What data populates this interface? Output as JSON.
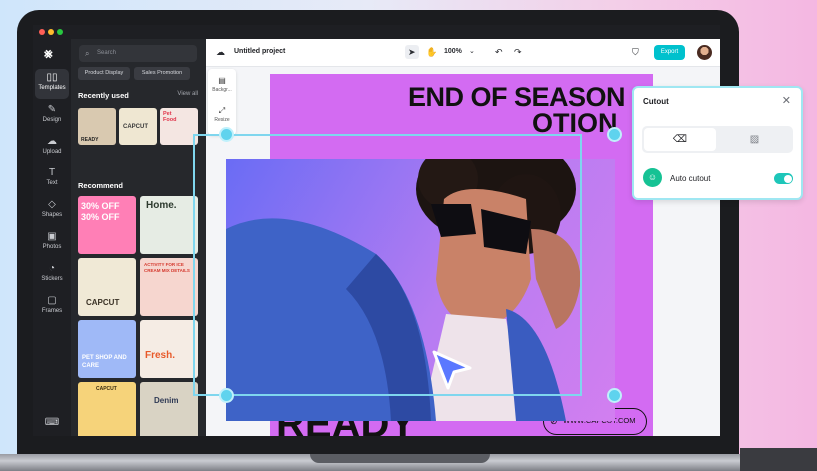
{
  "window": {
    "traffic_lights": [
      "#ff5f57",
      "#febc2e",
      "#28c840"
    ]
  },
  "rail": {
    "logo_icon": "capcut-logo-icon",
    "items": [
      {
        "label": "Templates",
        "icon": "templates-icon",
        "active": true
      },
      {
        "label": "Design",
        "icon": "design-icon"
      },
      {
        "label": "Upload",
        "icon": "upload-icon"
      },
      {
        "label": "Text",
        "icon": "text-icon"
      },
      {
        "label": "Shapes",
        "icon": "shapes-icon"
      },
      {
        "label": "Photos",
        "icon": "photos-icon"
      },
      {
        "label": "Stickers",
        "icon": "stickers-icon"
      },
      {
        "label": "Frames",
        "icon": "frames-icon"
      }
    ]
  },
  "panel": {
    "search_placeholder": "Search",
    "chips": [
      "Product Display",
      "Sales Promotion"
    ],
    "recently_used": "Recently used",
    "view_all": "View all",
    "recent_thumbs": [
      {
        "text": "READY",
        "color": "#d9c9b0"
      },
      {
        "text": "CAPCUT",
        "color": "#efe7d2"
      },
      {
        "text": "Pet Food",
        "color": "#f4e6e2"
      }
    ],
    "recommend": "Recommend",
    "grid": [
      {
        "text": "30% OFF 30% OFF",
        "color": "#ff7fb6"
      },
      {
        "text": "Home.",
        "color": "#e6ece4"
      },
      {
        "text": "CAPCUT",
        "color": "#f0e9d6"
      },
      {
        "text": "ACTIVITY FOR ICE CREAM MIX DETAILS",
        "color": "#f6d6cf"
      },
      {
        "text": "PET SHOP AND CARE",
        "color": "#9fb9f7"
      },
      {
        "text": "Fresh.",
        "color": "#f5ece4"
      },
      {
        "text": "CAPCUT",
        "color": "#f6d37a"
      },
      {
        "text": "Denim",
        "color": "#d9d3c4"
      }
    ]
  },
  "topbar": {
    "project_title": "Untitled project",
    "zoom": "100%",
    "export_label": "Export",
    "cloud_icon": "cloud-icon",
    "select_icon": "pointer-icon",
    "hand_icon": "hand-icon",
    "undo_icon": "undo-icon",
    "redo_icon": "redo-icon",
    "shield_icon": "shield-icon"
  },
  "minitool": {
    "background_label": "Backgr...",
    "resize_label": "Resize"
  },
  "canvas": {
    "headline_line1": "END OF SEASON",
    "headline_line2": "OTION",
    "bottom_text": "READY",
    "url": "WWW.CAPCUT.COM",
    "accent": "#d36bf2"
  },
  "cutout": {
    "title": "Cutout",
    "eraser_icon": "eraser-icon",
    "image_icon": "image-icon",
    "auto_label": "Auto cutout",
    "auto_enabled": true
  }
}
